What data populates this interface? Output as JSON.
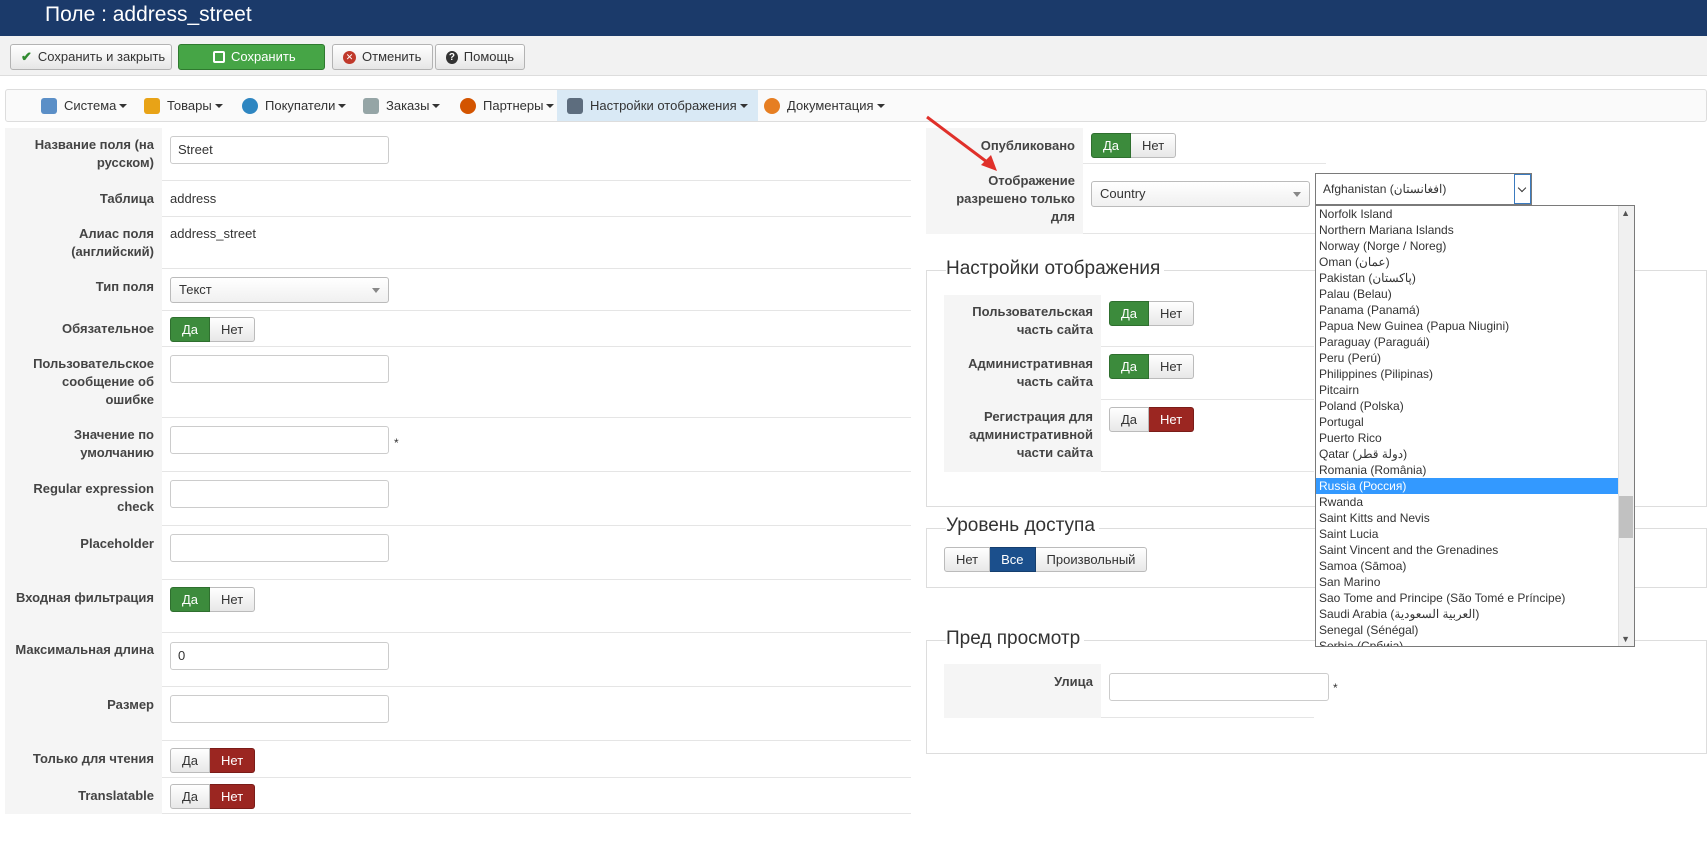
{
  "header": {
    "title": "Поле : address_street"
  },
  "toolbar": {
    "save_close": "Сохранить и закрыть",
    "save": "Сохранить",
    "cancel": "Отменить",
    "help": "Помощь"
  },
  "menu": {
    "items": [
      {
        "label": "Система",
        "icon": "tools-icon",
        "color": "#3b7bbf"
      },
      {
        "label": "Товары",
        "icon": "box-icon",
        "color": "#e8a317"
      },
      {
        "label": "Покупатели",
        "icon": "users-icon",
        "color": "#2e86c1"
      },
      {
        "label": "Заказы",
        "icon": "orders-icon",
        "color": "#7f8c8d"
      },
      {
        "label": "Партнеры",
        "icon": "partners-icon",
        "color": "#d35400"
      },
      {
        "label": "Настройки отображения",
        "icon": "display-icon",
        "color": "#5d6d7e"
      },
      {
        "label": "Документация",
        "icon": "docs-icon",
        "color": "#e67e22"
      }
    ],
    "active_index": 5
  },
  "left_form": {
    "name_ru_label": "Название поля (на русском)",
    "name_ru_value": "Street",
    "table_label": "Таблица",
    "table_value": "address",
    "alias_label": "Алиас поля (английский)",
    "alias_value": "address_street",
    "type_label": "Тип поля",
    "type_value": "Текст",
    "required_label": "Обязательное",
    "error_msg_label": "Пользовательское сообщение об ошибке",
    "default_label": "Значение по умолчанию",
    "regex_label": "Regular expression check",
    "placeholder_label": "Placeholder",
    "filter_label": "Входная фильтрация",
    "maxlen_label": "Максимальная длина",
    "maxlen_value": "0",
    "size_label": "Размер",
    "readonly_label": "Только для чтения",
    "translatable_label": "Translatable",
    "yes": "Да",
    "no": "Нет",
    "star": "*"
  },
  "right_form": {
    "published_label": "Опубликовано",
    "display_only_label": "Отображение разрешено только для",
    "country_select": "Country",
    "country_value": "Afghanistan (افغانستان)",
    "display_settings_legend": "Настройки отображения",
    "user_site_label": "Пользовательская часть сайта",
    "admin_site_label": "Административная часть сайта",
    "reg_admin_label": "Регистрация для административной части сайта",
    "access_legend": "Уровень доступа",
    "access_none": "Нет",
    "access_all": "Все",
    "access_custom": "Произвольный",
    "preview_legend": "Пред просмотр",
    "street_label": "Улица",
    "star": "*",
    "yes": "Да",
    "no": "Нет"
  },
  "country_list": {
    "items": [
      "Norfolk Island",
      "Northern Mariana Islands",
      "Norway (Norge / Noreg)",
      "Oman (عمان)",
      "Pakistan (پاکستان)",
      "Palau (Belau)",
      "Panama (Panamá)",
      "Papua New Guinea (Papua Niugini)",
      "Paraguay (Paraguái)",
      "Peru (Perú)",
      "Philippines (Pilipinas)",
      "Pitcairn",
      "Poland (Polska)",
      "Portugal",
      "Puerto Rico",
      "Qatar (دولة قطر)",
      "Romania (România)",
      "Russia (Россия)",
      "Rwanda",
      "Saint Kitts and Nevis",
      "Saint Lucia",
      "Saint Vincent and the Grenadines",
      "Samoa (Sāmoa)",
      "San Marino",
      "Sao Tome and Principe (São Tomé e Príncipe)",
      "Saudi Arabia (العربية السعودية)",
      "Senegal (Sénégal)",
      "Serbia (Србија)"
    ],
    "selected_index": 17
  }
}
